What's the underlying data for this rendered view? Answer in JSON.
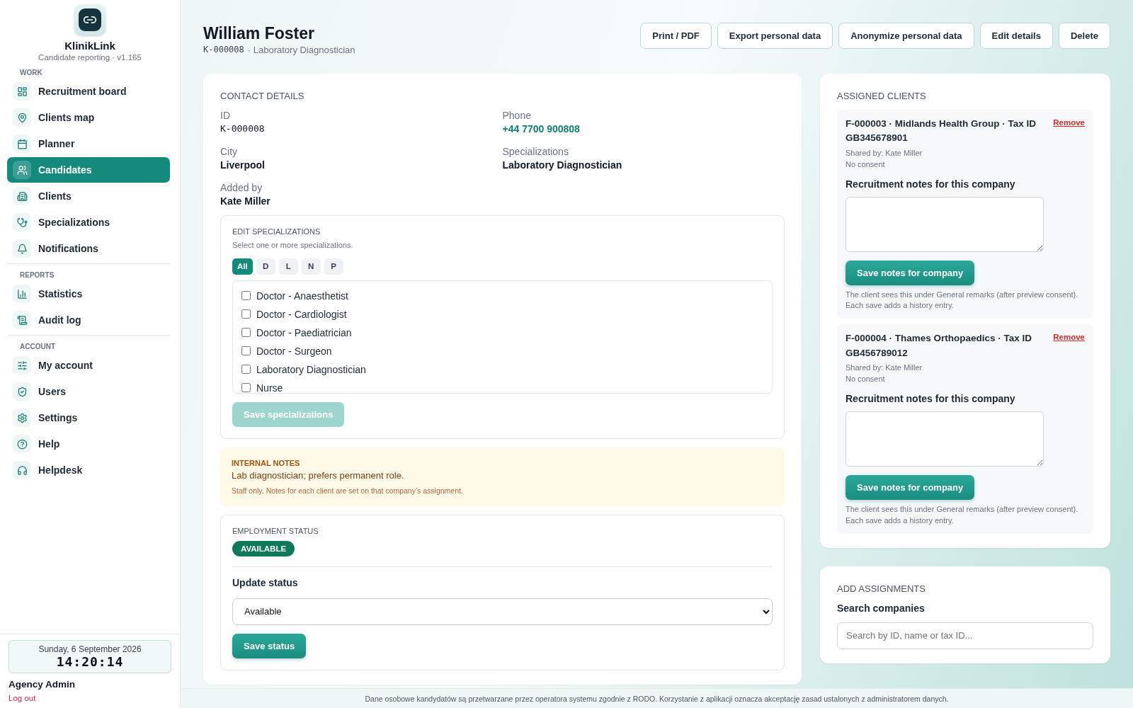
{
  "app": {
    "name": "KlinikLink",
    "subtitle": "Candidate reporting · v1.165"
  },
  "nav": [
    {
      "heading": "WORK",
      "items": [
        {
          "label": "Recruitment board",
          "selected": false
        },
        {
          "label": "Clients map",
          "selected": false
        },
        {
          "label": "Planner",
          "selected": false
        },
        {
          "label": "Candidates",
          "selected": true
        },
        {
          "label": "Clients",
          "selected": false
        },
        {
          "label": "Specializations",
          "selected": false
        },
        {
          "label": "Notifications",
          "selected": false
        }
      ]
    },
    {
      "heading": "REPORTS",
      "items": [
        {
          "label": "Statistics",
          "selected": false
        },
        {
          "label": "Audit log",
          "selected": false
        }
      ]
    },
    {
      "heading": "ACCOUNT",
      "items": [
        {
          "label": "My account",
          "selected": false
        },
        {
          "label": "Users",
          "selected": false
        },
        {
          "label": "Settings",
          "selected": false
        },
        {
          "label": "Help",
          "selected": false
        },
        {
          "label": "Helpdesk",
          "selected": false
        }
      ]
    }
  ],
  "clock": {
    "date": "Sunday, 6 September 2026",
    "time": "14:20:14"
  },
  "user": {
    "name": "Agency Admin",
    "logout": "Log out"
  },
  "header": {
    "name": "William Foster",
    "id": "K-000008",
    "role": "· Laboratory Diagnostician",
    "actions": [
      "Print / PDF",
      "Export personal data",
      "Anonymize personal data",
      "Edit details",
      "Delete"
    ]
  },
  "contact": {
    "title": "CONTACT DETAILS",
    "fields": [
      {
        "label": "ID",
        "value": "K-000008",
        "kind": "mono"
      },
      {
        "label": "Phone",
        "value": "+44 7700 900808",
        "kind": "link"
      },
      {
        "label": "City",
        "value": "Liverpool",
        "kind": "text"
      },
      {
        "label": "Specializations",
        "value": "Laboratory Diagnostician",
        "kind": "text"
      },
      {
        "label": "Added by",
        "value": "Kate Miller",
        "kind": "text"
      }
    ]
  },
  "edit_specializations": {
    "title": "EDIT SPECIALIZATIONS",
    "hint": "Select one or more specializations.",
    "filters": [
      {
        "label": "All",
        "selected": true
      },
      {
        "label": "D",
        "selected": false
      },
      {
        "label": "L",
        "selected": false
      },
      {
        "label": "N",
        "selected": false
      },
      {
        "label": "P",
        "selected": false
      }
    ],
    "options": [
      {
        "label": "Doctor - Anaesthetist",
        "checked": false
      },
      {
        "label": "Doctor - Cardiologist",
        "checked": false
      },
      {
        "label": "Doctor - Paediatrician",
        "checked": false
      },
      {
        "label": "Doctor - Surgeon",
        "checked": false
      },
      {
        "label": "Laboratory Diagnostician",
        "checked": false
      },
      {
        "label": "Nurse",
        "checked": false
      }
    ],
    "save": {
      "label": "Save specializations",
      "disabled": true
    }
  },
  "internal_notes": {
    "title": "INTERNAL NOTES",
    "text": "Lab diagnostician; prefers permanent role.",
    "hint": "Staff only. Notes for each client are set on that company’s assignment."
  },
  "employment": {
    "title": "EMPLOYMENT STATUS",
    "badge": "AVAILABLE",
    "update_label": "Update status",
    "select_value": "Available",
    "save": "Save status"
  },
  "assigned_clients": {
    "title": "ASSIGNED CLIENTS",
    "clients": [
      {
        "title": "F-000003 · Midlands Health Group · Tax ID GB345678901",
        "remove": "Remove",
        "shared": "Shared by: Kate Miller",
        "consent": "No consent",
        "notes_label": "Recruitment notes for this company",
        "save": "Save notes for company",
        "hint": "The client sees this under General remarks (after preview consent). Each save adds a history entry."
      },
      {
        "title": "F-000004 · Thames Orthopaedics · Tax ID GB456789012",
        "remove": "Remove",
        "shared": "Shared by: Kate Miller",
        "consent": "No consent",
        "notes_label": "Recruitment notes for this company",
        "save": "Save notes for company",
        "hint": "The client sees this under General remarks (after preview consent). Each save adds a history entry."
      }
    ]
  },
  "add_assignments": {
    "title": "ADD ASSIGNMENTS",
    "search_label": "Search companies",
    "placeholder": "Search by ID, name or tax ID..."
  },
  "footer": "Dane osobowe kandydatów są przetwarzane przez operatora systemu zgodnie z RODO. Korzystanie z aplikacji oznacza akceptację zasad ustalonych z administratorem danych."
}
